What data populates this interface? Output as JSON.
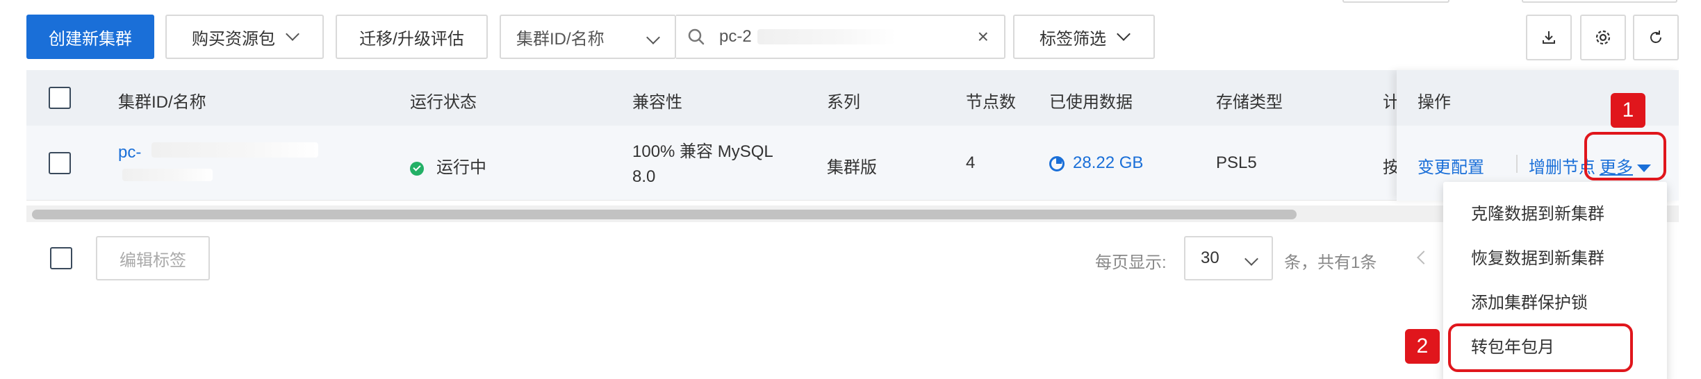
{
  "toolbar": {
    "create_label": "创建新集群",
    "buy_label": "购买资源包",
    "migrate_label": "迁移/升级评估",
    "filter_select": "集群ID/名称",
    "search_value": "pc-2",
    "clear_icon": "×",
    "tag_filter_label": "标签筛选"
  },
  "table": {
    "headers": {
      "id": "集群ID/名称",
      "status": "运行状态",
      "compat": "兼容性",
      "series": "系列",
      "nodes": "节点数",
      "used": "已使用数据",
      "storage": "存储类型",
      "truncated": "计",
      "ops": "操作"
    },
    "row": {
      "id": "pc-",
      "status": "运行中",
      "compat_line1": "100% 兼容 MySQL",
      "compat_line2": "8.0",
      "series": "集群版",
      "nodes": "4",
      "used": "28.22 GB",
      "storage": "PSL5",
      "truncated": "按",
      "op_modify": "变更配置",
      "op_nodes": "增删节点",
      "op_more": "更多"
    }
  },
  "footer": {
    "edit_tags_label": "编辑标签",
    "page_size_label": "每页显示:",
    "page_size_value": "30",
    "total_text": "条，共有1条"
  },
  "more_menu": {
    "items": [
      "克隆数据到新集群",
      "恢复数据到新集群",
      "添加集群保护锁",
      "转包年包月"
    ]
  },
  "annotations": {
    "badge1": "1",
    "badge2": "2"
  },
  "colors": {
    "primary": "#1a6fd8",
    "success": "#23b066",
    "annotation_red": "#e0161c"
  }
}
